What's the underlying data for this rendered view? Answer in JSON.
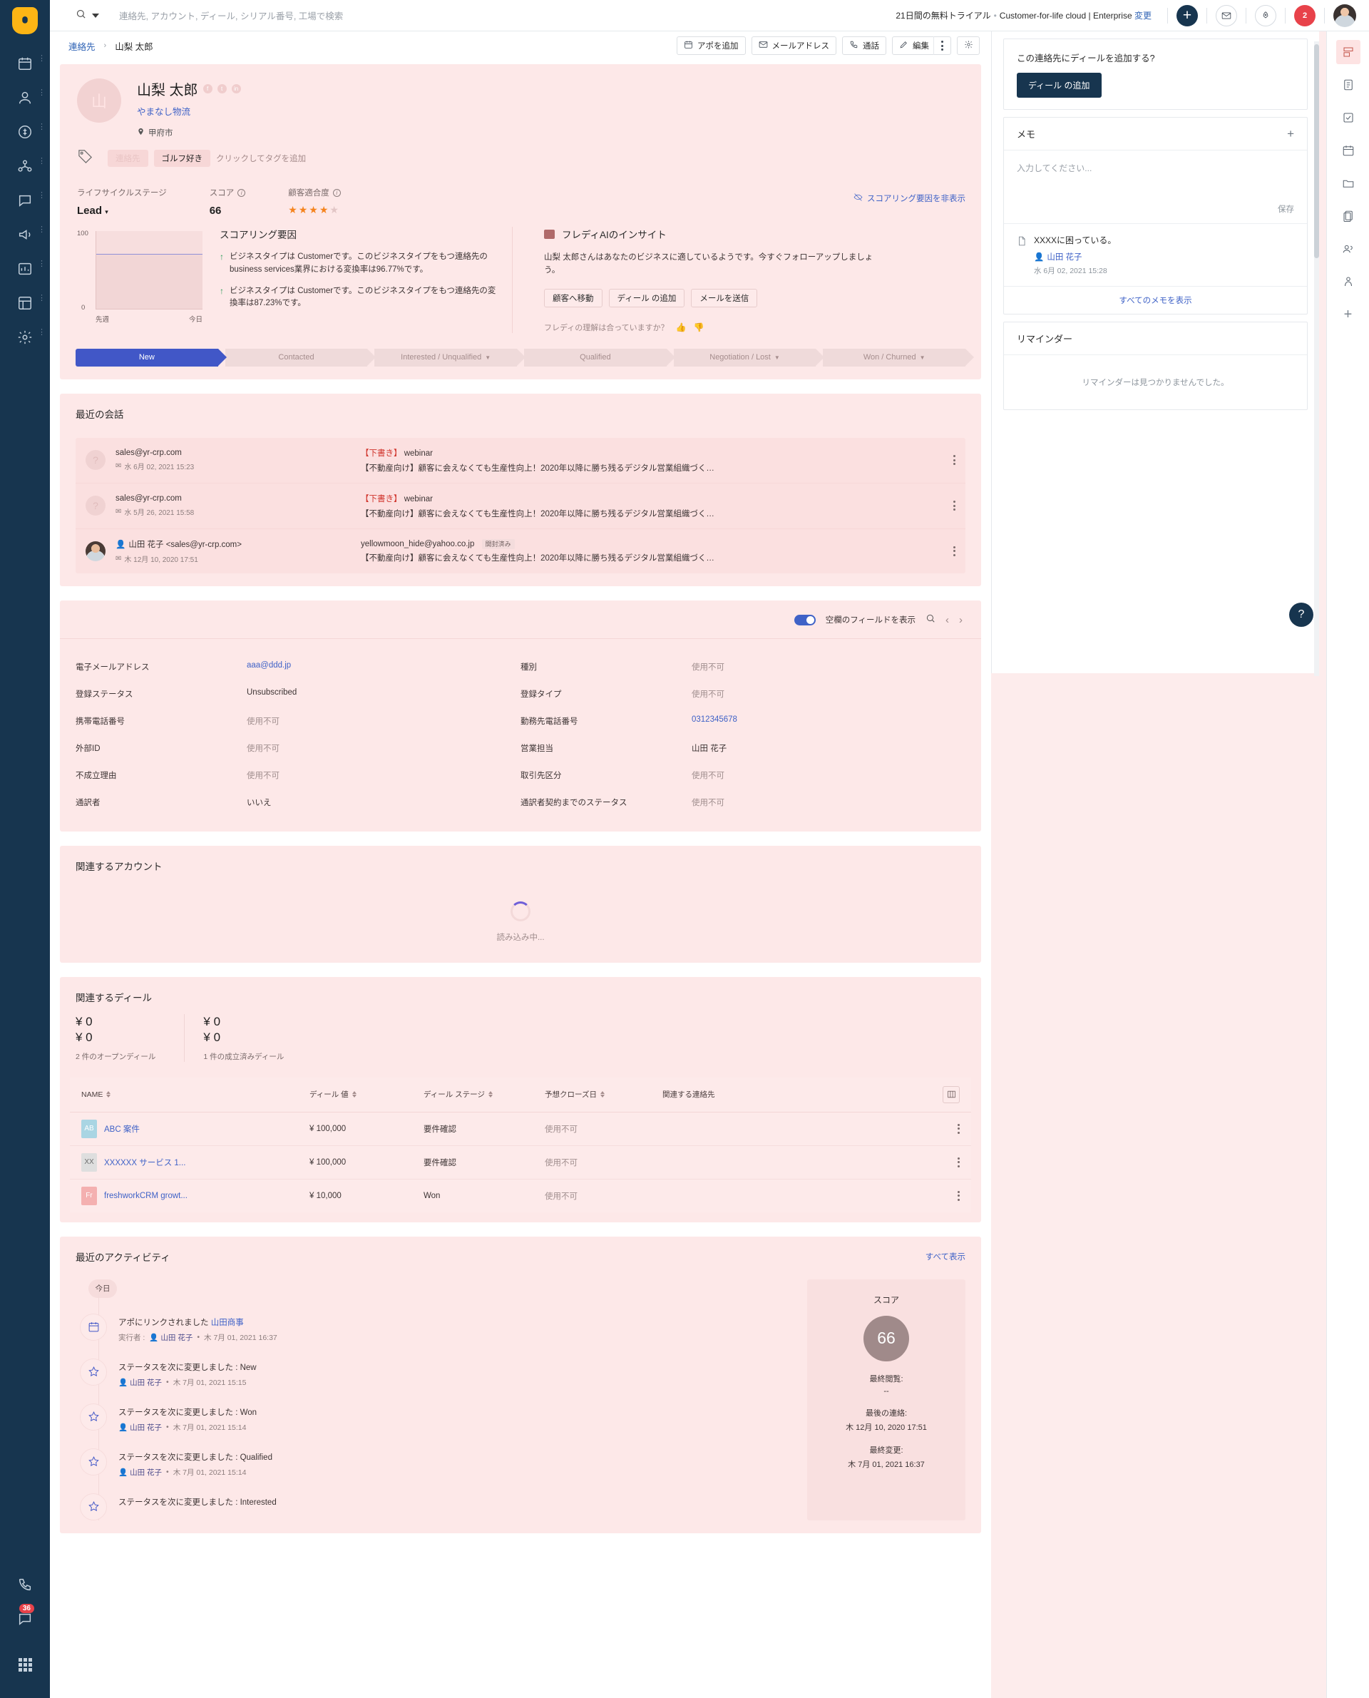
{
  "topbar": {
    "search_placeholder": "連絡先, アカウント, ディール, シリアル番号, 工場で検索",
    "trial_text": "21日間の無料トライアル",
    "plan_text": "Customer-for-life cloud | Enterprise",
    "change_link": "変更",
    "notification_count": "2"
  },
  "breadcrumb": {
    "root": "連絡先",
    "separator": "›",
    "current": "山梨 太郎"
  },
  "actions": {
    "appointment": "アポを追加",
    "email": "メールアドレス",
    "call": "通話",
    "edit": "編集"
  },
  "profile": {
    "initial": "山",
    "name": "山梨 太郎",
    "company": "やまなし物流",
    "location": "甲府市",
    "tags": [
      "連絡先",
      "ゴルフ好き"
    ],
    "tag_add": "クリックしてタグを追加"
  },
  "stats": {
    "lifecycle_label": "ライフサイクルステージ",
    "lifecycle_value": "Lead",
    "score_label": "スコア",
    "score_value": "66",
    "fit_label": "顧客適合度",
    "fit_stars": 4,
    "fit_stars_total": 5,
    "hide_scoring": "スコアリング要因を非表示"
  },
  "scoring": {
    "title": "スコアリング要因",
    "chart": {
      "ymax": "100",
      "ymin": "0",
      "x_start": "先週",
      "x_end": "今日"
    },
    "items": [
      "ビジネスタイプは Customerです。このビジネスタイプをもつ連絡先のbusiness services業界における変換率は96.77%です。",
      "ビジネスタイプは Customerです。このビジネスタイプをもつ連絡先の変換率は87.23%です。"
    ]
  },
  "freddy": {
    "title": "フレディAIのインサイト",
    "body": "山梨 太郎さんはあなたのビジネスに適しているようです。今すぐフォローアップしましょう。",
    "buttons": [
      "顧客へ移動",
      "ディール の追加",
      "メールを送信"
    ],
    "feedback": "フレディの理解は合っていますか？"
  },
  "pipeline": [
    {
      "label": "New",
      "active": true,
      "caret": false
    },
    {
      "label": "Contacted",
      "active": false,
      "caret": false
    },
    {
      "label": "Interested / Unqualified",
      "active": false,
      "caret": true
    },
    {
      "label": "Qualified",
      "active": false,
      "caret": false
    },
    {
      "label": "Negotiation / Lost",
      "active": false,
      "caret": true
    },
    {
      "label": "Won / Churned",
      "active": false,
      "caret": true
    }
  ],
  "conversations": {
    "title": "最近の会話",
    "rows": [
      {
        "from": "sales@yr-crp.com",
        "date": "水 6月 02, 2021 15:23",
        "draft": "【下書き】",
        "to": " webinar",
        "pill": "",
        "preview": "【不動産向け】顧客に会えなくても生産性向上！2020年以降に勝ち残るデジタル営業組織づく…",
        "photo": false
      },
      {
        "from": "sales@yr-crp.com",
        "date": "水 5月 26, 2021 15:58",
        "draft": "【下書き】",
        "to": " webinar",
        "pill": "",
        "preview": "【不動産向け】顧客に会えなくても生産性向上！2020年以降に勝ち残るデジタル営業組織づく…",
        "photo": false
      },
      {
        "from": "山田 花子 <sales@yr-crp.com>",
        "date": "木 12月 10, 2020 17:51",
        "draft": "",
        "to": "yellowmoon_hide@yahoo.co.jp",
        "pill": "開封済み",
        "preview": "【不動産向け】顧客に会えなくても生産性向上！2020年以降に勝ち残るデジタル営業組織づく…",
        "photo": true
      }
    ]
  },
  "fields": {
    "toggle_label": "空欄のフィールドを表示",
    "left": [
      {
        "label": "電子メールアドレス",
        "value": "aaa@ddd.jp",
        "type": "link"
      },
      {
        "label": "登録ステータス",
        "value": "Unsubscribed",
        "type": "text"
      },
      {
        "label": "携帯電話番号",
        "value": "使用不可",
        "type": "na"
      },
      {
        "label": "外部ID",
        "value": "使用不可",
        "type": "na"
      },
      {
        "label": "不成立理由",
        "value": "使用不可",
        "type": "na"
      },
      {
        "label": "通訳者",
        "value": "いいえ",
        "type": "text"
      }
    ],
    "right": [
      {
        "label": "種別",
        "value": "使用不可",
        "type": "na"
      },
      {
        "label": "登録タイプ",
        "value": "使用不可",
        "type": "na"
      },
      {
        "label": "勤務先電話番号",
        "value": "0312345678",
        "type": "link"
      },
      {
        "label": "営業担当",
        "value": "山田 花子",
        "type": "text"
      },
      {
        "label": "取引先区分",
        "value": "使用不可",
        "type": "na"
      },
      {
        "label": "通訳者契約までのステータス",
        "value": "使用不可",
        "type": "na"
      }
    ]
  },
  "related_account": {
    "title": "関連するアカウント",
    "loading": "読み込み中..."
  },
  "deals": {
    "title": "関連するディール",
    "summary": [
      {
        "amount1": "¥ 0",
        "amount2": "¥ 0",
        "label": "2 件のオープンディール"
      },
      {
        "amount1": "¥ 0",
        "amount2": "¥ 0",
        "label": "1 件の成立済みディール"
      }
    ],
    "columns": [
      "NAME",
      "ディール 値",
      "ディール ステージ",
      "予想クローズ日",
      "関連する連絡先"
    ],
    "rows": [
      {
        "initials": "AB",
        "initial_color": "#a9d5e3",
        "name": "ABC 案件",
        "value": "¥ 100,000",
        "stage": "要件確認",
        "close": "使用不可"
      },
      {
        "initials": "XX",
        "initial_color": "#dedede",
        "name": "XXXXXX  サービス  1...",
        "value": "¥ 100,000",
        "stage": "要件確認",
        "close": "使用不可"
      },
      {
        "initials": "Fr",
        "initial_color": "#f4b0b0",
        "name": "freshworkCRM  growt...",
        "value": "¥ 10,000",
        "stage": "Won",
        "close": "使用不可"
      }
    ]
  },
  "activity": {
    "title": "最近のアクティビティ",
    "show_all": "すべて表示",
    "today": "今日",
    "items": [
      {
        "icon": "calendar-icon",
        "text": "アポにリンクされました ",
        "link": "山田商事",
        "prefix": "実行者 : ",
        "who": "山田 花子",
        "date": "木 7月 01, 2021 16:37"
      },
      {
        "icon": "star-icon",
        "text": "ステータスを次に変更しました : New",
        "link": "",
        "prefix": "",
        "who": "山田 花子",
        "date": "木 7月 01, 2021 15:15"
      },
      {
        "icon": "star-icon",
        "text": "ステータスを次に変更しました : Won",
        "link": "",
        "prefix": "",
        "who": "山田 花子",
        "date": "木 7月 01, 2021 15:14"
      },
      {
        "icon": "star-icon",
        "text": "ステータスを次に変更しました : Qualified",
        "link": "",
        "prefix": "",
        "who": "山田 花子",
        "date": "木 7月 01, 2021 15:14"
      },
      {
        "icon": "star-icon",
        "text": "ステータスを次に変更しました : Interested",
        "link": "",
        "prefix": "",
        "who": "",
        "date": ""
      }
    ],
    "score_card": {
      "label": "スコア",
      "value": "66",
      "last_seen_label": "最終閲覧:",
      "last_seen_value": "--",
      "last_contact_label": "最後の連絡:",
      "last_contact_value": "木 12月 10, 2020 17:51",
      "last_modified_label": "最終変更:",
      "last_modified_value": "木 7月 01, 2021 16:37"
    }
  },
  "right_panel": {
    "prompt": "この連絡先にディールを追加する?",
    "cta": "ディール の追加",
    "notes_title": "メモ",
    "note_placeholder": "入力してください...",
    "save": "保存",
    "note": {
      "text": "XXXXに困っている。",
      "who": "山田 花子",
      "date": "水 6月 02, 2021 15:28"
    },
    "show_all_notes": "すべてのメモを表示",
    "reminders_title": "リマインダー",
    "reminders_empty": "リマインダーは見つかりませんでした。"
  },
  "left_rail": {
    "phone_badge": "36"
  }
}
